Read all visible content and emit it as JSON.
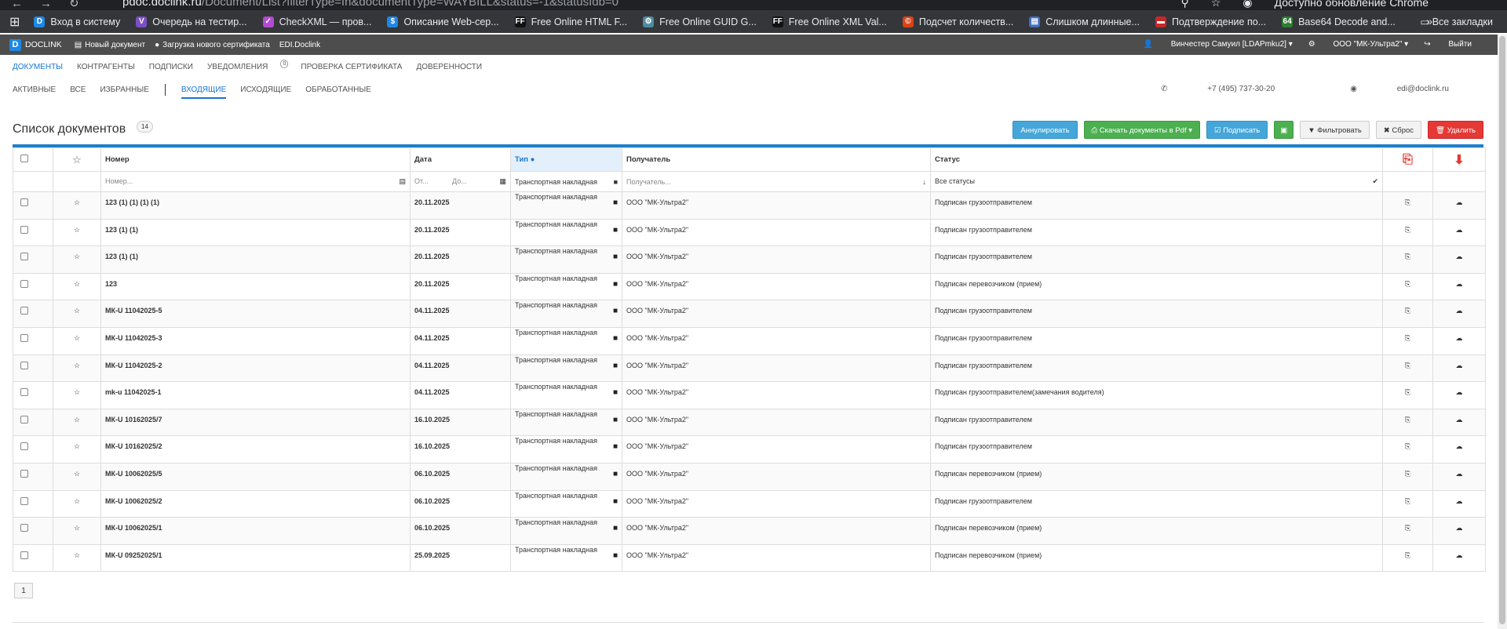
{
  "browser": {
    "url_host": "pdoc.doclink.ru",
    "url_path": "/Document/List?filterType=In&documentType=WAYBILL&status=-1&statusIdb=0",
    "update_notice": "Доступно обновление Chrome",
    "bookmarks": [
      {
        "label": "Вход в систему",
        "icon": "doclink-favicon",
        "color": "#1e88e5",
        "glyph": "D"
      },
      {
        "label": "Очередь на тестир...",
        "icon": "vs-favicon",
        "color": "#7b4fc6",
        "glyph": "V"
      },
      {
        "label": "CheckXML — пров...",
        "icon": "check-favicon",
        "color": "#b14bd1",
        "glyph": "✓"
      },
      {
        "label": "Описание Web-сер...",
        "icon": "dollar-favicon",
        "color": "#1e88e5",
        "glyph": "$"
      },
      {
        "label": "Free Online HTML F...",
        "icon": "ff-favicon",
        "color": "#111111",
        "glyph": "FF"
      },
      {
        "label": "Free Online GUID G...",
        "icon": "gear-favicon",
        "color": "#4c8c9e",
        "glyph": "⚙"
      },
      {
        "label": "Free Online XML Val...",
        "icon": "ff-favicon",
        "color": "#111111",
        "glyph": "FF"
      },
      {
        "label": "Подсчет количеств...",
        "icon": "copyright-favicon",
        "color": "#d84315",
        "glyph": "©"
      },
      {
        "label": "Слишком длинные...",
        "icon": "doc-favicon",
        "color": "#3f6fbf",
        "glyph": "▤"
      },
      {
        "label": "Подтверждение по...",
        "icon": "flag-favicon",
        "color": "#c62828",
        "glyph": "▬"
      },
      {
        "label": "Base64 Decode and...",
        "icon": "b64-favicon",
        "color": "#2e7d32",
        "glyph": "64"
      }
    ],
    "all_bookmarks": "Все закладки"
  },
  "appbar": {
    "logo": "DOCLINK",
    "items": [
      "Новый документ",
      "Загрузка нового сертификата",
      "EDI.Doclink"
    ],
    "user": "Винчестер Самуил [LDAPmku2]",
    "org": "ООО \"МК-Ультра2\"",
    "logout": "Выйти"
  },
  "topnav": {
    "items": [
      "ДОКУМЕНТЫ",
      "КОНТРАГЕНТЫ",
      "ПОДПИСКИ",
      "УВЕДОМЛЕНИЯ",
      "ПРОВЕРКА СЕРТИФИКАТА",
      "ДОВЕРЕННОСТИ"
    ],
    "notifications_count": "0"
  },
  "subnav": {
    "items": [
      "АКТИВНЫЕ",
      "ВСЕ",
      "ИЗБРАННЫЕ",
      "ВХОДЯЩИЕ",
      "ИСХОДЯЩИЕ",
      "ОБРАБОТАННЫЕ"
    ],
    "phone": "+7 (495) 737-30-20",
    "email": "edi@doclink.ru"
  },
  "list": {
    "title": "Список документов",
    "count": "14",
    "buttons": {
      "annul": "Аннулировать",
      "download": "Скачать документы в Pdf",
      "sign": "Подписать",
      "filter": "Фильтровать",
      "reset": "Сброс",
      "delete": "Удалить"
    }
  },
  "table": {
    "headers": {
      "number": "Номер",
      "date": "Дата",
      "type": "Тип",
      "recipient": "Получатель",
      "status": "Статус"
    },
    "filters": {
      "number_placeholder": "Номер...",
      "date_from": "От...",
      "date_to": "До...",
      "type_value": "Транспортная накладная",
      "recipient_placeholder": "Получатель...",
      "status_value": "Все статусы"
    },
    "rows": [
      {
        "number": "123 (1) (1) (1) (1)",
        "date": "20.11.2025",
        "type": "Транспортная накладная",
        "recipient": "ООО \"МК-Ультра2\"",
        "status": "Подписан грузоотправителем"
      },
      {
        "number": "123 (1) (1)",
        "date": "20.11.2025",
        "type": "Транспортная накладная",
        "recipient": "ООО \"МК-Ультра2\"",
        "status": "Подписан грузоотправителем"
      },
      {
        "number": "123 (1) (1)",
        "date": "20.11.2025",
        "type": "Транспортная накладная",
        "recipient": "ООО \"МК-Ультра2\"",
        "status": "Подписан грузоотправителем"
      },
      {
        "number": "123",
        "date": "20.11.2025",
        "type": "Транспортная накладная",
        "recipient": "ООО \"МК-Ультра2\"",
        "status": "Подписан перевозчиком (прием)"
      },
      {
        "number": "МК-U 11042025-5",
        "date": "04.11.2025",
        "type": "Транспортная накладная",
        "recipient": "ООО \"МК-Ультра2\"",
        "status": "Подписан грузоотправителем"
      },
      {
        "number": "МК-U 11042025-3",
        "date": "04.11.2025",
        "type": "Транспортная накладная",
        "recipient": "ООО \"МК-Ультра2\"",
        "status": "Подписан грузоотправителем"
      },
      {
        "number": "МК-U 11042025-2",
        "date": "04.11.2025",
        "type": "Транспортная накладная",
        "recipient": "ООО \"МК-Ультра2\"",
        "status": "Подписан грузоотправителем"
      },
      {
        "number": "mk-u 11042025-1",
        "date": "04.11.2025",
        "type": "Транспортная накладная",
        "recipient": "ООО \"МК-Ультра2\"",
        "status": "Подписан грузоотправителем(замечания водителя)"
      },
      {
        "number": "МК-U 10162025/7",
        "date": "16.10.2025",
        "type": "Транспортная накладная",
        "recipient": "ООО \"МК-Ультра2\"",
        "status": "Подписан грузоотправителем"
      },
      {
        "number": "МК-U 10162025/2",
        "date": "16.10.2025",
        "type": "Транспортная накладная",
        "recipient": "ООО \"МК-Ультра2\"",
        "status": "Подписан грузоотправителем"
      },
      {
        "number": "МК-U 10062025/5",
        "date": "06.10.2025",
        "type": "Транспортная накладная",
        "recipient": "ООО \"МК-Ультра2\"",
        "status": "Подписан перевозчиком (прием)"
      },
      {
        "number": "МК-U 10062025/2",
        "date": "06.10.2025",
        "type": "Транспортная накладная",
        "recipient": "ООО \"МК-Ультра2\"",
        "status": "Подписан грузоотправителем"
      },
      {
        "number": "МК-U 10062025/1",
        "date": "06.10.2025",
        "type": "Транспортная накладная",
        "recipient": "ООО \"МК-Ультра2\"",
        "status": "Подписан перевозчиком (прием)"
      },
      {
        "number": "МК-U 09252025/1",
        "date": "25.09.2025",
        "type": "Транспортная накладная",
        "recipient": "ООО \"МК-Ультра2\"",
        "status": "Подписан перевозчиком (прием)"
      }
    ]
  },
  "pager": {
    "current": "1"
  },
  "colors": {
    "accent": "#1976d2",
    "pdf_red": "#e53935",
    "download_blue": "#1e88e5"
  }
}
